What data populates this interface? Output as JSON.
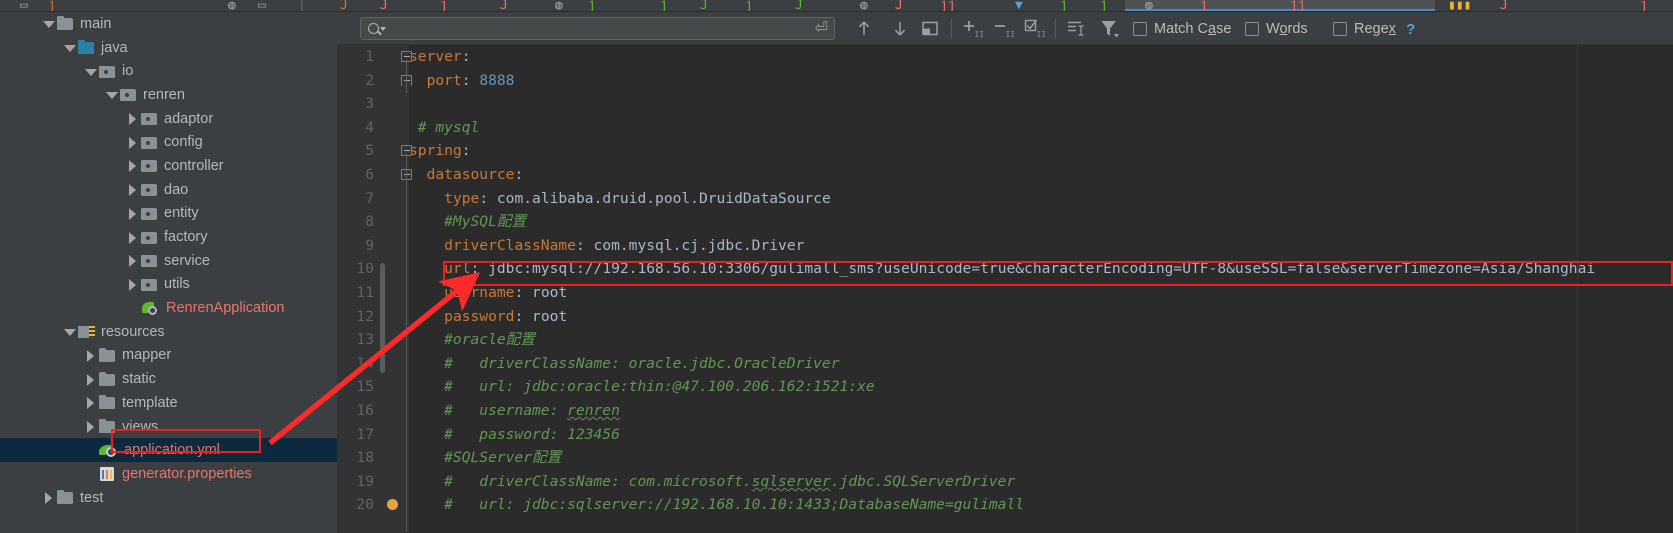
{
  "window": {
    "tab_strip_note": "partially visible editor tab strip"
  },
  "project_tree": {
    "name": "project-file-tree",
    "items": [
      {
        "label": "main",
        "indent": 0,
        "arrow": "down",
        "icon": "folder",
        "color": "normal"
      },
      {
        "label": "java",
        "indent": 1,
        "arrow": "down",
        "icon": "folder-blue",
        "color": "normal"
      },
      {
        "label": "io",
        "indent": 2,
        "arrow": "down",
        "icon": "folder-pkg",
        "color": "normal"
      },
      {
        "label": "renren",
        "indent": 3,
        "arrow": "down",
        "icon": "folder-pkg",
        "color": "normal"
      },
      {
        "label": "adaptor",
        "indent": 4,
        "arrow": "right",
        "icon": "folder-pkg",
        "color": "normal"
      },
      {
        "label": "config",
        "indent": 4,
        "arrow": "right",
        "icon": "folder-pkg",
        "color": "normal"
      },
      {
        "label": "controller",
        "indent": 4,
        "arrow": "right",
        "icon": "folder-pkg",
        "color": "normal"
      },
      {
        "label": "dao",
        "indent": 4,
        "arrow": "right",
        "icon": "folder-pkg",
        "color": "normal"
      },
      {
        "label": "entity",
        "indent": 4,
        "arrow": "right",
        "icon": "folder-pkg",
        "color": "normal"
      },
      {
        "label": "factory",
        "indent": 4,
        "arrow": "right",
        "icon": "folder-pkg",
        "color": "normal"
      },
      {
        "label": "service",
        "indent": 4,
        "arrow": "right",
        "icon": "folder-pkg",
        "color": "normal"
      },
      {
        "label": "utils",
        "indent": 4,
        "arrow": "right",
        "icon": "folder-pkg",
        "color": "normal"
      },
      {
        "label": "RenrenApplication",
        "indent": 4,
        "arrow": "none",
        "icon": "spring",
        "color": "red"
      },
      {
        "label": "resources",
        "indent": 1,
        "arrow": "down",
        "icon": "folder-res",
        "color": "normal"
      },
      {
        "label": "mapper",
        "indent": 2,
        "arrow": "right",
        "icon": "folder",
        "color": "normal"
      },
      {
        "label": "static",
        "indent": 2,
        "arrow": "right",
        "icon": "folder",
        "color": "normal"
      },
      {
        "label": "template",
        "indent": 2,
        "arrow": "right",
        "icon": "folder",
        "color": "normal"
      },
      {
        "label": "views",
        "indent": 2,
        "arrow": "right",
        "icon": "folder",
        "color": "normal"
      },
      {
        "label": "application.yml",
        "indent": 2,
        "arrow": "none",
        "icon": "yml",
        "color": "red",
        "selected": true,
        "highlighted": true
      },
      {
        "label": "generator.properties",
        "indent": 2,
        "arrow": "none",
        "icon": "props",
        "color": "red"
      },
      {
        "label": "test",
        "indent": 0,
        "arrow": "right",
        "icon": "folder",
        "color": "normal"
      }
    ]
  },
  "find_toolbar": {
    "name": "find-in-file-toolbar",
    "search_value": "",
    "search_placeholder": "",
    "buttons": [
      {
        "name": "prev-occurrence-button",
        "glyph": "↑"
      },
      {
        "name": "next-occurrence-button",
        "glyph": "↓"
      },
      {
        "name": "select-all-occurrences-button",
        "glyph": "▣"
      },
      {
        "name": "add-line-button",
        "glyph": "+"
      },
      {
        "name": "remove-line-button",
        "glyph": "−"
      },
      {
        "name": "toggle-selection-button",
        "glyph": "☑"
      },
      {
        "name": "filter-lines-button",
        "glyph": "≡"
      },
      {
        "name": "filter-funnel-button",
        "glyph": "▼"
      }
    ],
    "checkboxes": [
      {
        "label": "Match Case",
        "mnemonic": "C",
        "checked": false
      },
      {
        "label": "Words",
        "mnemonic": "o",
        "checked": false
      },
      {
        "label": "Regex",
        "mnemonic": "x",
        "checked": false
      }
    ],
    "help_label": "?"
  },
  "editor": {
    "name": "code-editor-application-yml",
    "file": "application.yml",
    "lines": [
      {
        "n": "1",
        "tokens": [
          {
            "t": "server",
            "c": "k"
          },
          {
            "t": ":",
            "c": "p"
          }
        ],
        "fold": "open"
      },
      {
        "n": "2",
        "tokens": [
          {
            "t": "  ",
            "c": "p"
          },
          {
            "t": "port",
            "c": "k"
          },
          {
            "t": ": ",
            "c": "p"
          },
          {
            "t": "8888",
            "c": "num"
          }
        ],
        "fold": "end"
      },
      {
        "n": "3",
        "tokens": []
      },
      {
        "n": "4",
        "tokens": [
          {
            "t": " # mysql",
            "c": "cmt"
          }
        ]
      },
      {
        "n": "5",
        "tokens": [
          {
            "t": "spring",
            "c": "k"
          },
          {
            "t": ":",
            "c": "p"
          }
        ],
        "fold": "open"
      },
      {
        "n": "6",
        "tokens": [
          {
            "t": "  ",
            "c": "p"
          },
          {
            "t": "datasource",
            "c": "k"
          },
          {
            "t": ":",
            "c": "p"
          }
        ],
        "fold": "open2"
      },
      {
        "n": "7",
        "tokens": [
          {
            "t": "    ",
            "c": "p"
          },
          {
            "t": "type",
            "c": "k"
          },
          {
            "t": ": ",
            "c": "p"
          },
          {
            "t": "com.alibaba.druid.pool.DruidDataSource",
            "c": "v"
          }
        ]
      },
      {
        "n": "8",
        "tokens": [
          {
            "t": "    #MySQL配置",
            "c": "cmt"
          }
        ]
      },
      {
        "n": "9",
        "tokens": [
          {
            "t": "    ",
            "c": "p"
          },
          {
            "t": "driverClassName",
            "c": "k"
          },
          {
            "t": ": ",
            "c": "p"
          },
          {
            "t": "com.mysql.cj.jdbc.Driver",
            "c": "v"
          }
        ]
      },
      {
        "n": "10",
        "tokens": [
          {
            "t": "    ",
            "c": "p"
          },
          {
            "t": "url",
            "c": "k"
          },
          {
            "t": ": ",
            "c": "p"
          },
          {
            "t": "jdbc:mysql://192.168.56.10:3306/gulimall_sms?useUnicode=true&characterEncoding=UTF-8&useSSL=false&serverTimezone=Asia/Shanghai",
            "c": "v"
          }
        ],
        "boxed": true
      },
      {
        "n": "11",
        "tokens": [
          {
            "t": "    ",
            "c": "p"
          },
          {
            "t": "username",
            "c": "k"
          },
          {
            "t": ": ",
            "c": "p"
          },
          {
            "t": "root",
            "c": "v"
          }
        ]
      },
      {
        "n": "12",
        "tokens": [
          {
            "t": "    ",
            "c": "p"
          },
          {
            "t": "password",
            "c": "k"
          },
          {
            "t": ": ",
            "c": "p"
          },
          {
            "t": "root",
            "c": "v"
          }
        ]
      },
      {
        "n": "13",
        "tokens": [
          {
            "t": "    #oracle配置",
            "c": "cmt"
          }
        ]
      },
      {
        "n": "14",
        "tokens": [
          {
            "t": "    #   driverClassName: oracle.jdbc.OracleDriver",
            "c": "cmt"
          }
        ]
      },
      {
        "n": "15",
        "tokens": [
          {
            "t": "    #   url: jdbc:oracle:thin:@47.100.206.162:1521:xe",
            "c": "cmt"
          }
        ]
      },
      {
        "n": "16",
        "tokens": [
          {
            "t": "    #   username: ",
            "c": "cmt"
          },
          {
            "t": "renren",
            "c": "cmt-typo"
          }
        ]
      },
      {
        "n": "17",
        "tokens": [
          {
            "t": "    #   password: 123456",
            "c": "cmt"
          }
        ]
      },
      {
        "n": "18",
        "tokens": [
          {
            "t": "    #SQLServer配置",
            "c": "cmt"
          }
        ]
      },
      {
        "n": "19",
        "tokens": [
          {
            "t": "    #   driverClassName: com.microsoft.",
            "c": "cmt"
          },
          {
            "t": "sqlserver",
            "c": "cmt-typo"
          },
          {
            "t": ".jdbc.SQLServerDriver",
            "c": "cmt"
          }
        ]
      },
      {
        "n": "20",
        "tokens": [
          {
            "t": "    #   url: jdbc:sqlserver://192.168.10.10:1433;DatabaseName=gulimall",
            "c": "cmt"
          }
        ],
        "warn": true
      }
    ]
  },
  "annotations": {
    "url_box": {
      "color": "#ee1f1f",
      "target": "url line 10"
    },
    "file_box": {
      "color": "#ee1f1f",
      "target": "application.yml"
    },
    "arrow": {
      "color": "#fb2b2b",
      "from": "application.yml",
      "to": "url line 10"
    }
  },
  "colors": {
    "ide_chrome": "#3c3f41",
    "editor_bg": "#2b2b2b",
    "gutter_bg": "#313335",
    "selection_bg": "#0d293e",
    "key": "#cc7832",
    "value": "#a9b7c6",
    "number": "#6897bb",
    "comment": "#629755",
    "accent_red": "#ee1f1f",
    "tab_underline": "#4a88c7"
  }
}
